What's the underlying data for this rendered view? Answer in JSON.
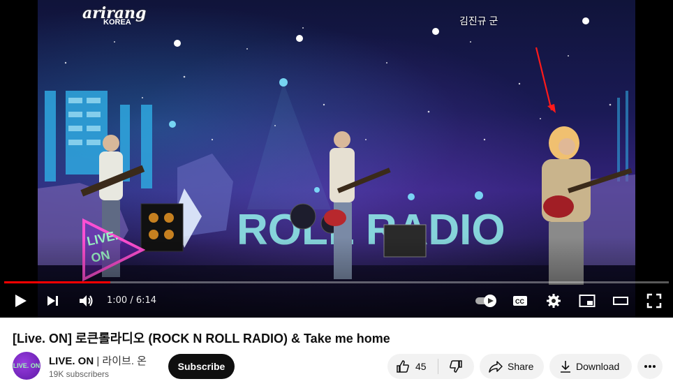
{
  "video": {
    "watermark": {
      "logo": "arirang",
      "sub": "KOREA"
    },
    "caption": "김진규 군",
    "badge": {
      "line1": "LIVE.",
      "line2": "ON"
    },
    "stage_sign": "ROLL RADIO"
  },
  "player": {
    "time_current": "1:00",
    "time_separator": " / ",
    "time_total": "6:14",
    "progress_fraction": 0.16,
    "buffer_fraction": 0.16,
    "accent_color": "#ff0000",
    "icons": [
      "play-icon",
      "next-icon",
      "volume-icon",
      "autoplay-toggle",
      "captions-icon",
      "settings-icon",
      "miniplayer-icon",
      "theater-icon",
      "fullscreen-icon"
    ]
  },
  "meta": {
    "title": "[Live. ON] 로큰롤라디오 (ROCK N ROLL RADIO) & Take me home",
    "channel_name": "LIVE. ON",
    "channel_name_suffix": " | 라이브. 온",
    "avatar_text": "LIVE. ON",
    "subscribers": "19K subscribers",
    "subscribe_label": "Subscribe",
    "like_count": "45",
    "share_label": "Share",
    "download_label": "Download"
  }
}
